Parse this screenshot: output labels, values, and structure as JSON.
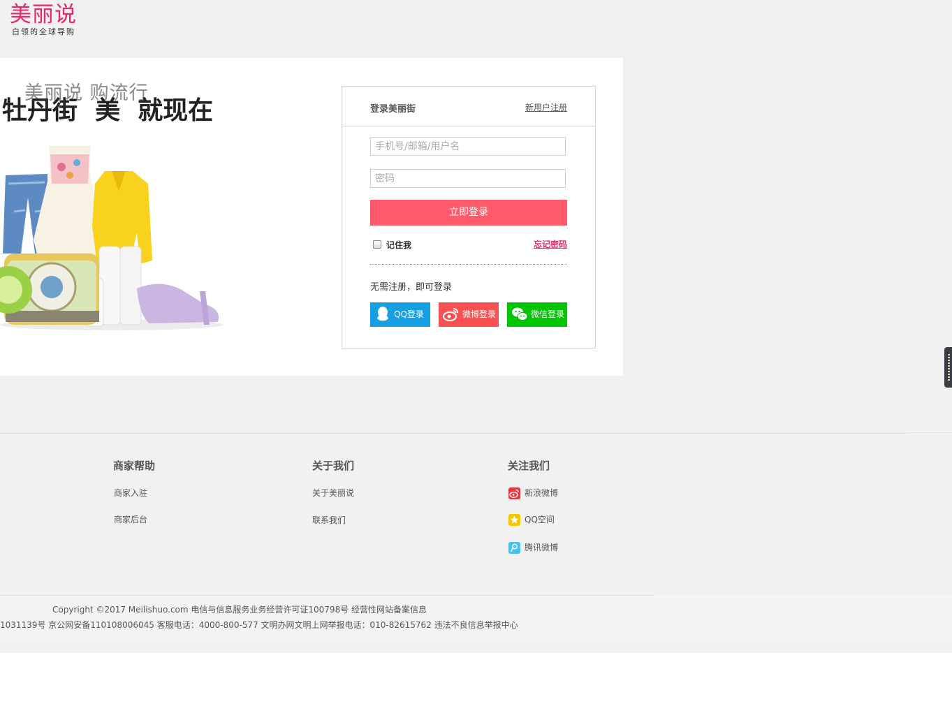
{
  "logo": {
    "name": "美丽说",
    "tagline": "白领的全球导购"
  },
  "hero": {
    "slogan_back": "美丽说 购流行",
    "slogan_front": "牡丹街  美  就现在"
  },
  "login": {
    "title": "登录美丽街",
    "register_link": "新用户注册",
    "username_placeholder": "手机号/邮箱/用户名",
    "password_placeholder": "密码",
    "submit_label": "立即登录",
    "remember_label": "记住我",
    "forgot_label": "忘记密码",
    "quick_login_title": "无需注册，即可登录",
    "social": [
      {
        "label": "QQ登录",
        "color": "#16a0e3",
        "icon": "qq-icon"
      },
      {
        "label": "微博登录",
        "color": "#f95051",
        "icon": "weibo-icon"
      },
      {
        "label": "微信登录",
        "color": "#01c500",
        "icon": "wechat-icon"
      }
    ]
  },
  "footer": {
    "merchant": {
      "title": "商家帮助",
      "items": [
        "商家入驻",
        "商家后台"
      ]
    },
    "about": {
      "title": "关于我们",
      "items": [
        "关于美丽说",
        "联系我们"
      ]
    },
    "follow": {
      "title": "关注我们",
      "items": [
        {
          "label": "新浪微博",
          "icon": "sina-weibo-icon",
          "color": "#e6393f"
        },
        {
          "label": "QQ空间",
          "icon": "qzone-icon",
          "color": "#f7c400"
        },
        {
          "label": "腾讯微博",
          "icon": "tencent-weibo-icon",
          "color": "#4cc0ea"
        }
      ]
    }
  },
  "copyright": {
    "line1": "Copyright ©2017 Meilishuo.com  电信与信息服务业务经营许可证100798号 经营性网站备案信息",
    "line2": "1031139号  京公网安备110108006045   客服电话：4000-800-577   文明办网文明上网举报电话：010-82615762   违法不良信息举报中心"
  },
  "colors": {
    "brand": "#e8286c",
    "login_button": "#ff5a6a"
  }
}
